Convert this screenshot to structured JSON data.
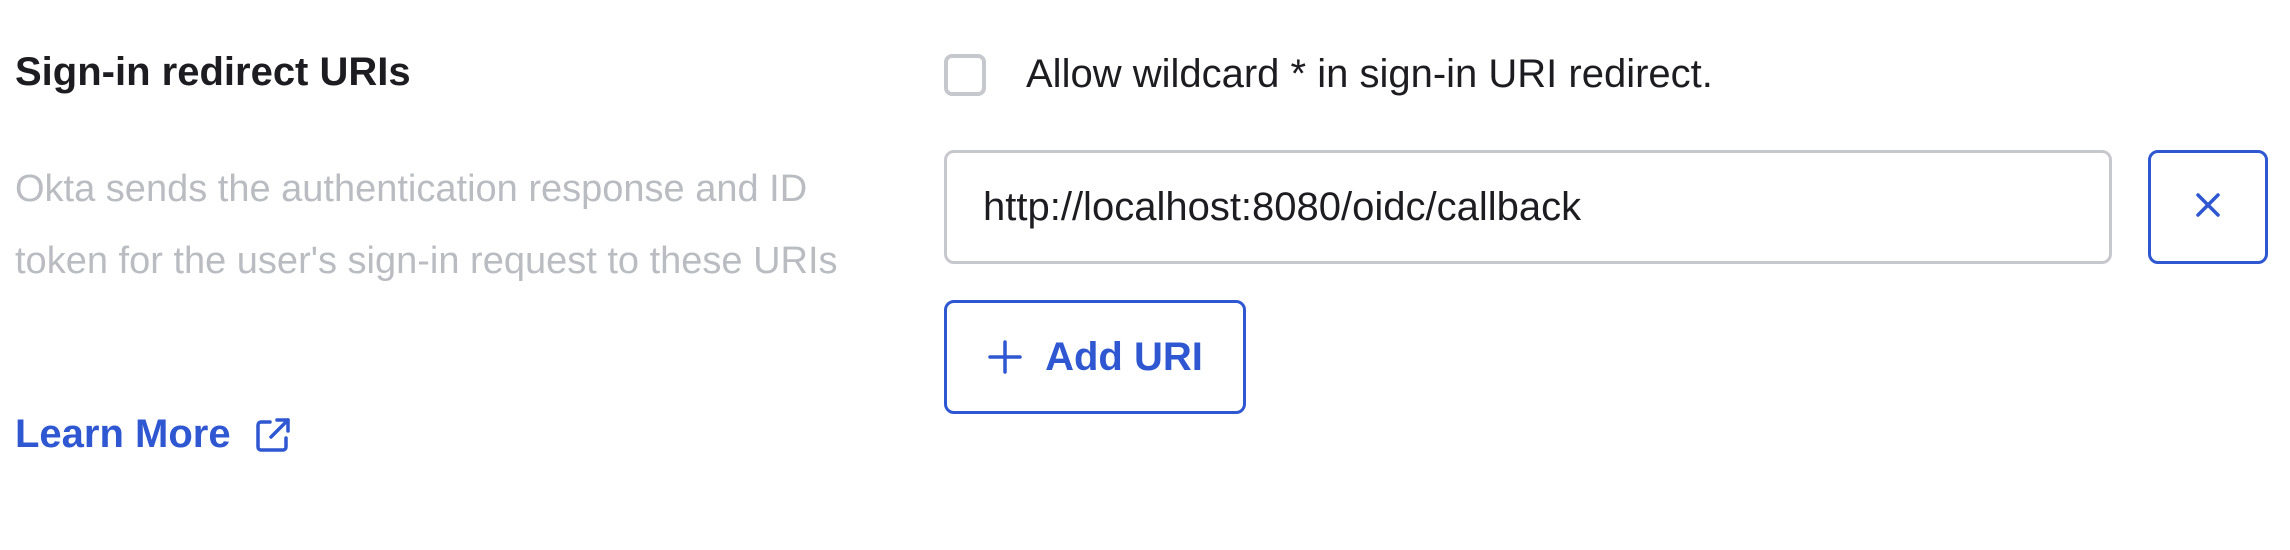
{
  "field": {
    "title": "Sign-in redirect URIs",
    "description": "Okta sends the authentication response and ID token for the user's sign-in request to these URIs",
    "learn_more_label": "Learn More",
    "learn_more_icon": "external-link-icon"
  },
  "wildcard": {
    "checked": false,
    "label": "Allow wildcard * in sign-in URI redirect."
  },
  "uris": [
    {
      "value": "http://localhost:8080/oidc/callback",
      "remove_icon": "close-icon"
    }
  ],
  "add_button": {
    "label": "Add URI",
    "icon": "plus-icon"
  },
  "colors": {
    "accent": "#2e57d1",
    "muted_text": "#babcc2",
    "border": "#c6c8ce",
    "text": "#1d1d21"
  }
}
